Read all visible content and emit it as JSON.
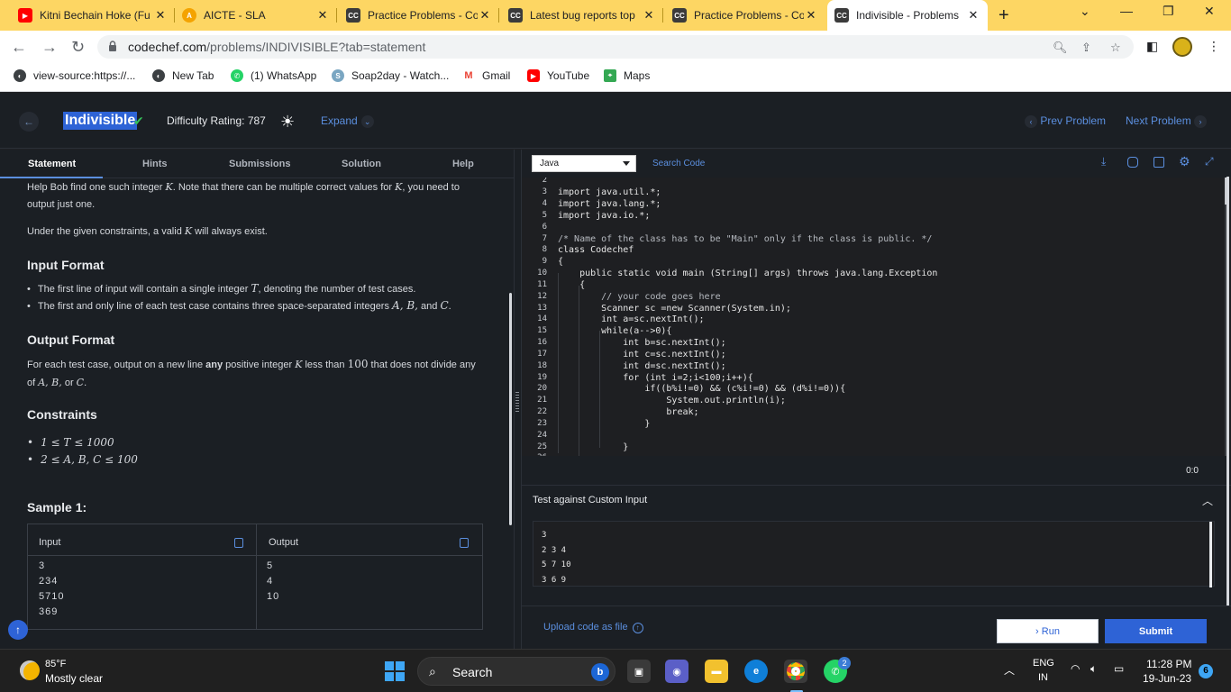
{
  "browser": {
    "tabs": [
      {
        "title": "Kitni Bechain Hoke (Fu",
        "icon": "youtube-icon"
      },
      {
        "title": "AICTE - SLA",
        "icon": "aicte-icon"
      },
      {
        "title": "Practice Problems - Co",
        "icon": "codechef-icon"
      },
      {
        "title": "Latest bug reports top",
        "icon": "codechef-icon"
      },
      {
        "title": "Practice Problems - Co",
        "icon": "codechef-icon"
      },
      {
        "title": "Indivisible - Problems",
        "icon": "codechef-icon"
      }
    ],
    "new_tab": "+",
    "url_host": "codechef.com",
    "url_path": "/problems/INDIVISIBLE?tab=statement",
    "bookmarks": [
      {
        "label": "view-source:https://...",
        "icon": "globe-icon"
      },
      {
        "label": "New Tab",
        "icon": "globe-icon"
      },
      {
        "label": "(1) WhatsApp",
        "icon": "whatsapp-icon"
      },
      {
        "label": "Soap2day - Watch...",
        "icon": "soap2day-icon"
      },
      {
        "label": "Gmail",
        "icon": "gmail-icon"
      },
      {
        "label": "YouTube",
        "icon": "youtube-icon"
      },
      {
        "label": "Maps",
        "icon": "maps-icon"
      }
    ]
  },
  "header": {
    "title": "Indivisible",
    "difficulty": "Difficulty Rating: 787",
    "expand": "Expand",
    "prev": "Prev Problem",
    "next": "Next Problem"
  },
  "left_tabs": [
    "Statement",
    "Hints",
    "Submissions",
    "Solution",
    "Help"
  ],
  "statement": {
    "p1a": "Help Bob find one such integer ",
    "p1v": "K",
    "p1b": ". Note that there can be multiple correct values for ",
    "p1v2": "K",
    "p1c": ", you need to",
    "p1d": "output just one.",
    "p2a": "Under the given constraints, a valid ",
    "p2v": "K",
    "p2b": " will always exist.",
    "input_h": "Input Format",
    "input_b1a": "The first line of input will contain a single integer ",
    "input_b1v": "T",
    "input_b1b": ", denoting the number of test cases.",
    "input_b2a": "The first and only line of each test case contains three space-separated integers ",
    "input_b2v": "A, B,",
    "input_b2b": " and ",
    "input_b2v2": "C",
    "input_b2c": ".",
    "output_h": "Output Format",
    "output_a": "For each test case, output on a new line ",
    "output_bold": "any",
    "output_b": " positive integer ",
    "output_v": "K",
    "output_c": " less than ",
    "output_v2": "100",
    "output_d": " that does not divide any",
    "output_e_v": "A, B,",
    "output_e_b": " or ",
    "output_e_v2": "C",
    "output_e_c": ".",
    "output_e_pre": "of ",
    "constraints_h": "Constraints",
    "c1": "1 ≤ T ≤ 1000",
    "c2": "2 ≤ A, B, C ≤ 100",
    "sample_h": "Sample 1:",
    "sample_input_h": "Input",
    "sample_output_h": "Output",
    "sample_input": "3\n234\n5710\n369",
    "sample_output": "5\n4\n10"
  },
  "editor": {
    "language": "Java",
    "search": "Search Code",
    "line_numbers": [
      "2",
      "3",
      "4",
      "5",
      "6",
      "7",
      "8",
      "9",
      "10",
      "11",
      "12",
      "13",
      "14",
      "15",
      "16",
      "17",
      "18",
      "19",
      "20",
      "21",
      "22",
      "23",
      "24",
      "25",
      "26"
    ],
    "lines": [
      "",
      "import java.util.*;",
      "import java.lang.*;",
      "import java.io.*;",
      "",
      "/* Name of the class has to be \"Main\" only if the class is public. */",
      "class Codechef",
      "{",
      "    public static void main (String[] args) throws java.lang.Exception",
      "    {",
      "        // your code goes here",
      "        Scanner sc =new Scanner(System.in);",
      "        int a=sc.nextInt();",
      "        while(a-->0){",
      "            int b=sc.nextInt();",
      "            int c=sc.nextInt();",
      "            int d=sc.nextInt();",
      "            for (int i=2;i<100;i++){",
      "                if((b%i!=0) && (c%i!=0) && (d%i!=0)){",
      "                    System.out.println(i);",
      "                    break;",
      "                }",
      "",
      "            }",
      ""
    ],
    "counter": "0:0"
  },
  "custom_input": {
    "label": "Test against Custom Input",
    "value": "3\n2 3 4\n5 7 10\n3 6 9"
  },
  "footer": {
    "upload": "Upload code as file",
    "run": "› Run",
    "submit": "Submit"
  },
  "taskbar": {
    "temp": "85°F",
    "weather": "Mostly clear",
    "search": "Search",
    "lang1": "ENG",
    "lang2": "IN",
    "time": "11:28 PM",
    "date": "19-Jun-23",
    "notifications": "6",
    "whatsapp_badge": "2"
  }
}
